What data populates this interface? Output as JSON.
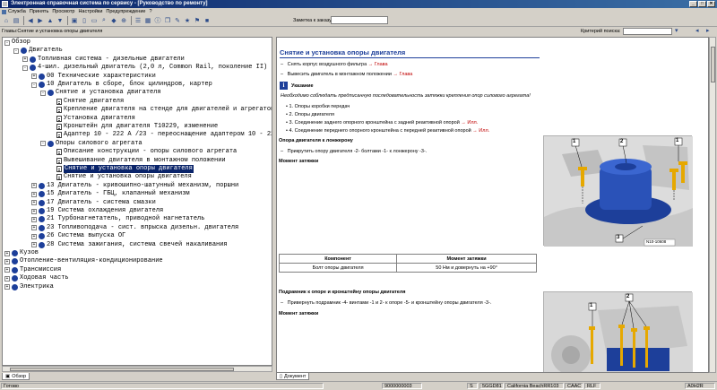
{
  "window": {
    "title": "Электронная справочная система по сервису - [Руководство по ремонту]",
    "buttons": [
      "_",
      "□",
      "✕"
    ]
  },
  "menu": [
    {
      "label": "Служба"
    },
    {
      "label": "Принять"
    },
    {
      "label": "Просмотр"
    },
    {
      "label": "Настройки"
    },
    {
      "label": "Предупреждение"
    },
    {
      "label": "?"
    }
  ],
  "toolbar": {
    "order_label": "Заметка к заказу:",
    "order_value": ""
  },
  "crumbs": {
    "path": "Главы:Снятие и установка опоры двигателя",
    "search_label": "Критерий поиска:",
    "search_value": ""
  },
  "tree": [
    {
      "label": "Обзор",
      "level": 0,
      "icon": "none",
      "exp": "-"
    },
    {
      "label": "Двигатель",
      "level": 1,
      "icon": "book",
      "exp": "-"
    },
    {
      "label": "Топливная система - дизельные двигатели",
      "level": 2,
      "icon": "book",
      "exp": "+"
    },
    {
      "label": "4-шил. дизельный двигатель (2,0 л, Common Rail, поколение II)",
      "level": 2,
      "icon": "book",
      "exp": "-"
    },
    {
      "label": "00 Технические характеристики",
      "level": 3,
      "icon": "book",
      "exp": "+"
    },
    {
      "label": "10 Двигатель в сборе, блок цилиндров, картер",
      "level": 3,
      "icon": "book",
      "exp": "-"
    },
    {
      "label": "Снятие и установка двигателя",
      "level": 4,
      "icon": "book",
      "exp": "-"
    },
    {
      "label": "Снятие двигателя",
      "level": 5,
      "icon": "doc",
      "exp": ""
    },
    {
      "label": "Крепление двигателя на стенде для двигателей и агрегатов тр",
      "level": 5,
      "icon": "doc",
      "exp": ""
    },
    {
      "label": "Установка двигателя",
      "level": 5,
      "icon": "doc",
      "exp": ""
    },
    {
      "label": "Кронштейн для двигателя Т10229, изменение",
      "level": 5,
      "icon": "doc",
      "exp": ""
    },
    {
      "label": "Адаптер 10 - 222 А /23 - переоснащение адаптером 10 - 222 А",
      "level": 5,
      "icon": "doc",
      "exp": ""
    },
    {
      "label": "Опоры силового агрегата",
      "level": 4,
      "icon": "book",
      "exp": "-"
    },
    {
      "label": "Описание конструкции - опоры силового агрегата",
      "level": 5,
      "icon": "doc",
      "exp": ""
    },
    {
      "label": "Вывешивание двигателя в монтажном положении",
      "level": 5,
      "icon": "doc",
      "exp": ""
    },
    {
      "label": "Снятие и установка опоры двигателя",
      "level": 5,
      "icon": "doc",
      "exp": "",
      "selected": true
    },
    {
      "label": "Снятие и установка опоры двигателя",
      "level": 5,
      "icon": "doc",
      "exp": ""
    },
    {
      "label": "13 Двигатель - кривошипно-шатунный механизм, поршни",
      "level": 3,
      "icon": "book",
      "exp": "+"
    },
    {
      "label": "15 Двигатель - ГБЦ, клапанный механизм",
      "level": 3,
      "icon": "book",
      "exp": "+"
    },
    {
      "label": "17 Двигатель - система смазки",
      "level": 3,
      "icon": "book",
      "exp": "+"
    },
    {
      "label": "19 Система охлаждения двигателя",
      "level": 3,
      "icon": "book",
      "exp": "+"
    },
    {
      "label": "21 Турбонагнетатель, приводной нагнетатель",
      "level": 3,
      "icon": "book",
      "exp": "+"
    },
    {
      "label": "23 Топливоподача - сист. впрыска дизельн. двигателя",
      "level": 3,
      "icon": "book",
      "exp": "+"
    },
    {
      "label": "26 Система выпуска ОГ",
      "level": 3,
      "icon": "book",
      "exp": "+"
    },
    {
      "label": "28 Система зажигания, система свечей накаливания",
      "level": 3,
      "icon": "book",
      "exp": "+"
    },
    {
      "label": "Кузов",
      "level": 0,
      "icon": "book",
      "exp": "+"
    },
    {
      "label": "Отопление-вентиляция-кондиционирование",
      "level": 0,
      "icon": "book",
      "exp": "+"
    },
    {
      "label": "Трансмиссия",
      "level": 0,
      "icon": "book",
      "exp": "+"
    },
    {
      "label": "Ходовая часть",
      "level": 0,
      "icon": "book",
      "exp": "+"
    },
    {
      "label": "Электрика",
      "level": 0,
      "icon": "book",
      "exp": "+"
    }
  ],
  "tree_tab": "Обзор",
  "doc_tab": "Документ",
  "doc": {
    "title": "Снятие и установка опоры двигателя",
    "step1_text": "Снять корпус воздушного фильтра",
    "step1_link": "→ Глава",
    "step2_text": "Вывесить двигатель в монтажном положении",
    "step2_link": "→ Глава",
    "note_icon": "i",
    "note_head": "Указание",
    "note_text": "Необходимо соблюдать предписанную последовательность затяжки крепления опор силового агрегата!",
    "order": [
      {
        "text": "1. Опоры коробки передач",
        "link": ""
      },
      {
        "text": "2. Опоры двигателя",
        "link": ""
      },
      {
        "text": "3. Соединение заднего опорного кронштейна с задней реактивной опорой",
        "link": "→ Илл."
      },
      {
        "text": "4. Соединение переднего опорного кронштейна с передней реактивной опорой",
        "link": "→ Илл."
      }
    ],
    "sec1_head": "Опора двигателя к лонжерону",
    "sec1_step": "Прикрутить опору двигателя -2- болтами -1- к лонжерону -3-.",
    "sec1_torque": "Момент затяжки",
    "table": {
      "headers": [
        "Компонент",
        "Момент затяжки"
      ],
      "rows": [
        [
          "Болт опоры двигателя",
          "50 Нм и довернуть на +90°"
        ]
      ]
    },
    "sec2_head": "Подрамник к опоре и кронштейну опоры двигателя",
    "sec2_step": "Привернуть подрамник -4- винтами -1 и 2- к опоре -5- и кронштейну опоры двигателя -3-.",
    "sec2_torque": "Момент затяжки",
    "fig1": {
      "callouts": [
        "1",
        "2",
        "1",
        "3"
      ],
      "id": "N10-10608"
    },
    "fig2": {
      "callouts": [
        "1",
        "2"
      ]
    }
  },
  "status": {
    "ready": "Готово",
    "code": "9000000003",
    "s": "S",
    "vin": "5GGD81",
    "model": "California BeachRR103",
    "c1": "CAAC",
    "c2": "RLF",
    "right": "A0H2R"
  }
}
